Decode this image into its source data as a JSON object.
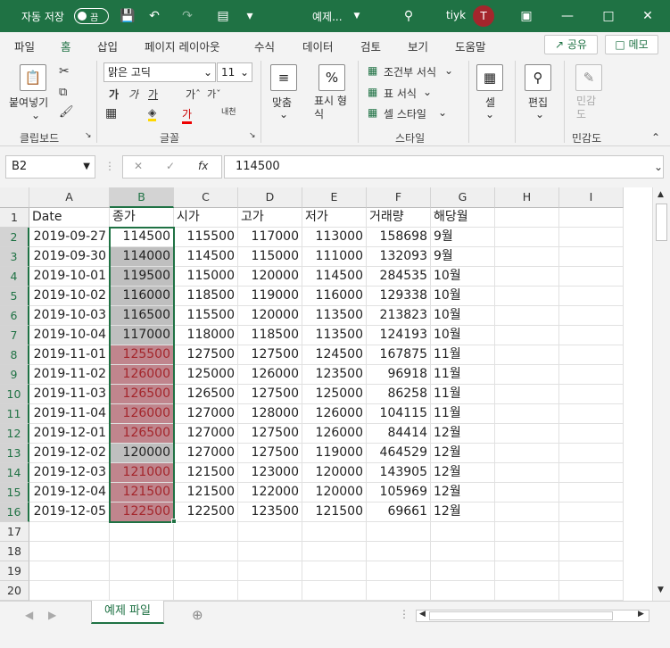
{
  "titlebar": {
    "autosave_label": "자동 저장",
    "autosave_state": "끔",
    "doc_title": "예제...",
    "user_name": "tiyk",
    "user_initial": "T"
  },
  "menu": [
    "파일",
    "홈",
    "삽입",
    "페이지 레이아웃",
    "수식",
    "데이터",
    "검토",
    "보기",
    "도움말"
  ],
  "menu_active_index": 1,
  "share_label": "공유",
  "memo_label": "메모",
  "ribbon": {
    "paste_label": "붙여넣기",
    "font_name": "맑은 고딕",
    "font_size": "11",
    "align_label": "맞춤",
    "number_label": "표시 형식",
    "conditional_format": "조건부 서식",
    "table_format": "표 서식",
    "cell_style": "셀 스타일",
    "cells_label": "셀",
    "edit_label": "편집",
    "sensitivity_label": "민감도",
    "groups": [
      "클립보드",
      "글꼴",
      "스타일",
      "민감도"
    ]
  },
  "formula_bar": {
    "name_box": "B2",
    "fx": "fx",
    "value": "114500"
  },
  "columns": [
    "A",
    "B",
    "C",
    "D",
    "E",
    "F",
    "G",
    "H",
    "I"
  ],
  "selected_column": "B",
  "rows": [
    "1",
    "2",
    "3",
    "4",
    "5",
    "6",
    "7",
    "8",
    "9",
    "10",
    "11",
    "12",
    "13",
    "14",
    "15",
    "16",
    "17",
    "18",
    "19",
    "20"
  ],
  "headers": [
    "Date",
    "종가",
    "시가",
    "고가",
    "저가",
    "거래량",
    "해당월"
  ],
  "table": [
    [
      "2019-09-27",
      "114500",
      "115500",
      "117000",
      "113000",
      "158698",
      "9월",
      "none"
    ],
    [
      "2019-09-30",
      "114000",
      "114500",
      "115000",
      "111000",
      "132093",
      "9월",
      "gray"
    ],
    [
      "2019-10-01",
      "119500",
      "115000",
      "120000",
      "114500",
      "284535",
      "10월",
      "gray"
    ],
    [
      "2019-10-02",
      "116000",
      "118500",
      "119000",
      "116000",
      "129338",
      "10월",
      "gray"
    ],
    [
      "2019-10-03",
      "116500",
      "115500",
      "120000",
      "113500",
      "213823",
      "10월",
      "gray"
    ],
    [
      "2019-10-04",
      "117000",
      "118000",
      "118500",
      "113500",
      "124193",
      "10월",
      "gray"
    ],
    [
      "2019-11-01",
      "125500",
      "127500",
      "127500",
      "124500",
      "167875",
      "11월",
      "red"
    ],
    [
      "2019-11-02",
      "126000",
      "125000",
      "126000",
      "123500",
      "96918",
      "11월",
      "red"
    ],
    [
      "2019-11-03",
      "126500",
      "126500",
      "127500",
      "125000",
      "86258",
      "11월",
      "red"
    ],
    [
      "2019-11-04",
      "126000",
      "127000",
      "128000",
      "126000",
      "104115",
      "11월",
      "red"
    ],
    [
      "2019-12-01",
      "126500",
      "127000",
      "127500",
      "126000",
      "84414",
      "12월",
      "red"
    ],
    [
      "2019-12-02",
      "120000",
      "127000",
      "127500",
      "119000",
      "464529",
      "12월",
      "gray"
    ],
    [
      "2019-12-03",
      "121000",
      "121500",
      "123000",
      "120000",
      "143905",
      "12월",
      "red"
    ],
    [
      "2019-12-04",
      "121500",
      "121500",
      "122000",
      "120000",
      "105969",
      "12월",
      "red"
    ],
    [
      "2019-12-05",
      "122500",
      "122500",
      "123500",
      "121500",
      "69661",
      "12월",
      "red"
    ]
  ],
  "sheet_tab": "예제 파일"
}
